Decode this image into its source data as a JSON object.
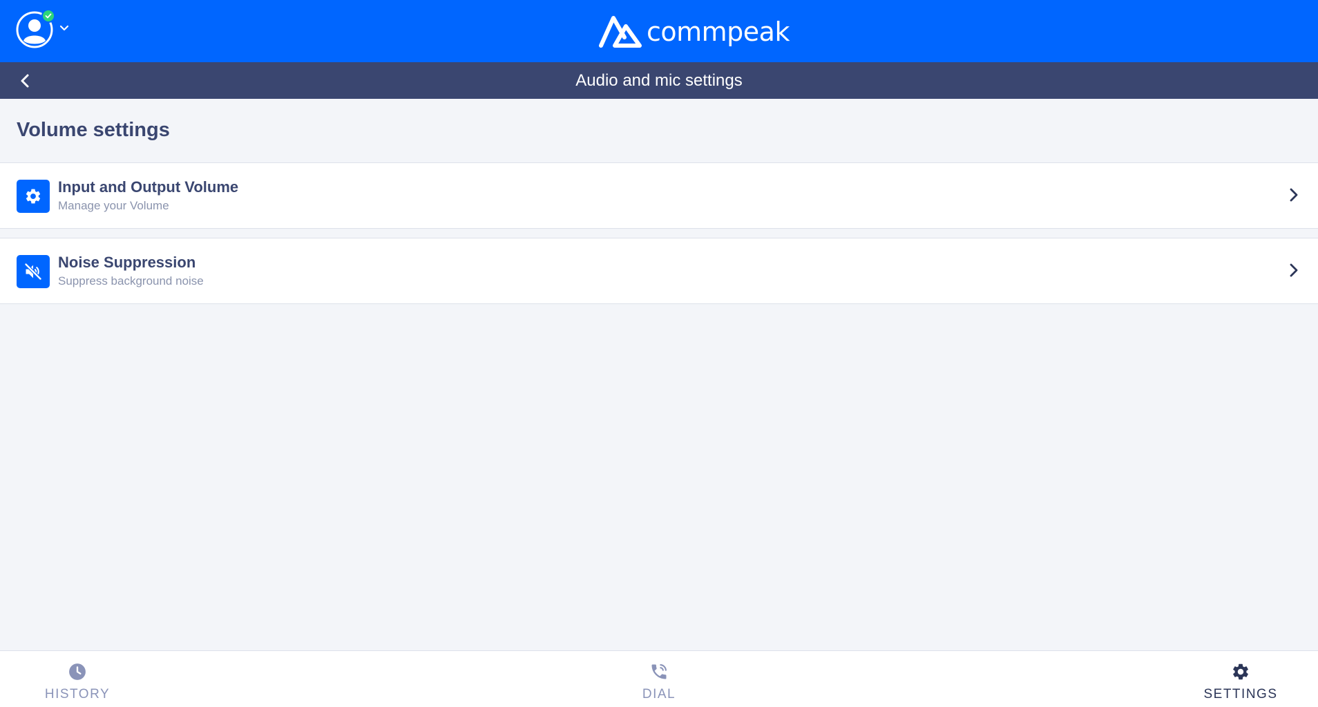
{
  "header": {
    "brand": "commpeak",
    "status": "online",
    "colors": {
      "primary": "#0066ff",
      "subbar": "#3a4670",
      "status_online": "#2ed47a"
    }
  },
  "subheader": {
    "title": "Audio and mic settings"
  },
  "main": {
    "section_title": "Volume settings",
    "items": [
      {
        "title": "Input and Output Volume",
        "subtitle": "Manage your Volume",
        "icon": "gear-icon"
      },
      {
        "title": "Noise Suppression",
        "subtitle": "Suppress background noise",
        "icon": "speaker-mute-icon"
      }
    ]
  },
  "bottom_nav": {
    "items": [
      {
        "label": "HISTORY",
        "icon": "clock-icon",
        "active": false
      },
      {
        "label": "DIAL",
        "icon": "phone-icon",
        "active": false
      },
      {
        "label": "SETTINGS",
        "icon": "gear-icon",
        "active": true
      }
    ]
  }
}
